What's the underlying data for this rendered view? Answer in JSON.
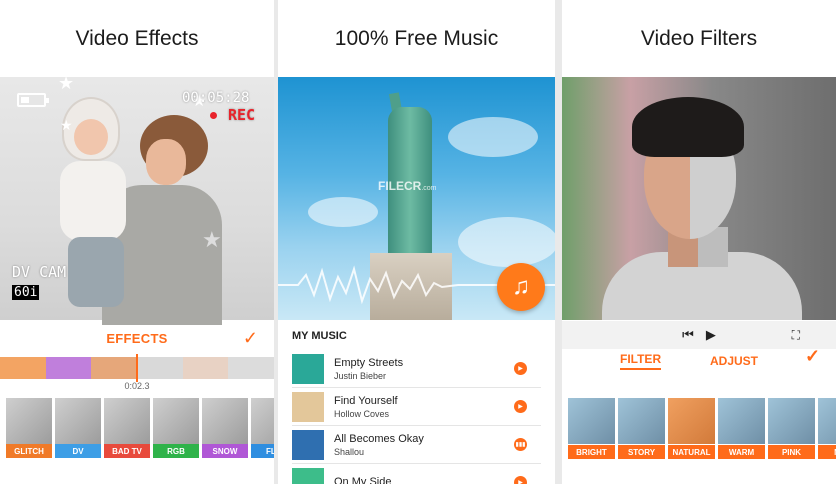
{
  "panels": {
    "effects": {
      "caption": "Video Effects",
      "hud": {
        "timecode": "00:05:28",
        "rec": "REC",
        "camera": "DV CAM",
        "mode": "60i"
      },
      "tab_label": "EFFECTS",
      "playhead_time": "0:02.3",
      "effects": [
        {
          "label": "GLITCH",
          "color": "#f07a28"
        },
        {
          "label": "DV",
          "color": "#3d9ee6"
        },
        {
          "label": "BAD TV",
          "color": "#e84a3c"
        },
        {
          "label": "RGB",
          "color": "#2fb34a"
        },
        {
          "label": "SNOW",
          "color": "#b057d6"
        },
        {
          "label": "FLO",
          "color": "#2f8ee0"
        }
      ]
    },
    "music": {
      "caption": "100% Free Music",
      "watermark": "FILECR",
      "watermark_sub": ".com",
      "section_title": "MY MUSIC",
      "songs": [
        {
          "title": "Empty Streets",
          "artist": "Justin Bieber",
          "state": "play"
        },
        {
          "title": "Find Yourself",
          "artist": "Hollow  Coves",
          "state": "play"
        },
        {
          "title": "All Becomes Okay",
          "artist": "Shallou",
          "state": "playing"
        },
        {
          "title": "On My Side",
          "artist": "",
          "state": "play"
        }
      ]
    },
    "filters": {
      "caption": "Video Filters",
      "tabs": [
        {
          "label": "FILTER",
          "active": true
        },
        {
          "label": "ADJUST",
          "active": false
        }
      ],
      "filters": [
        {
          "label": "BRIGHT",
          "color": "#ff6b1a"
        },
        {
          "label": "STORY",
          "color": "#ff6b1a"
        },
        {
          "label": "NATURAL",
          "color": "#ff6b1a"
        },
        {
          "label": "WARM",
          "color": "#ff6b1a"
        },
        {
          "label": "PINK",
          "color": "#ff6b1a"
        },
        {
          "label": "MIR",
          "color": "#ff6b1a"
        }
      ]
    }
  },
  "colors": {
    "accent": "#ff6b1a"
  }
}
